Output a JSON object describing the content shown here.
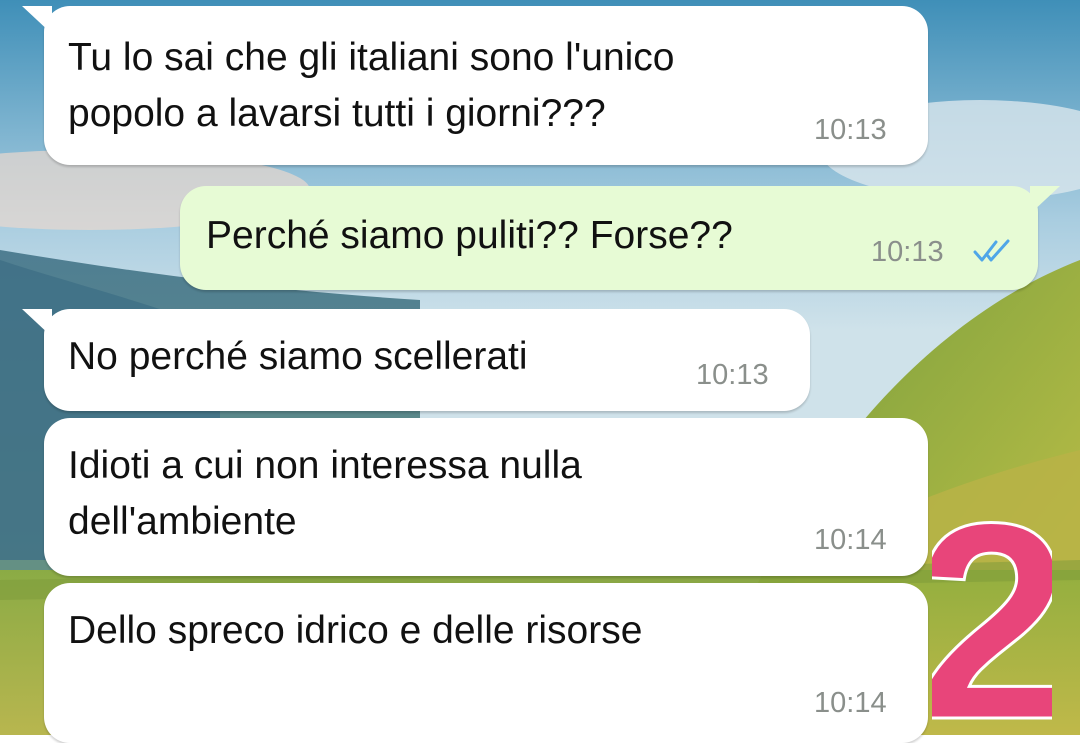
{
  "chat": {
    "messages": [
      {
        "direction": "incoming",
        "text": "Tu lo sai che gli italiani sono l'unico\npopolo a lavarsi tutti i giorni???",
        "time": "10:13"
      },
      {
        "direction": "outgoing",
        "text": "Perché siamo puliti?? Forse??",
        "time": "10:13",
        "status": "read"
      },
      {
        "direction": "incoming",
        "text": "No perché siamo scellerati",
        "time": "10:13"
      },
      {
        "direction": "incoming",
        "text": "Idioti a cui non interessa nulla\ndell'ambiente",
        "time": "10:14"
      },
      {
        "direction": "incoming",
        "text": "Dello spreco idrico e delle risorse",
        "time": "10:14"
      }
    ]
  },
  "overlay": {
    "sticker_text": "2",
    "sticker_color": "#e8457a"
  },
  "colors": {
    "incoming_bubble": "#ffffff",
    "outgoing_bubble": "#e7fbd5",
    "read_ticks": "#4fa6e8",
    "timestamp": "#8a8f8b"
  },
  "icons": {
    "read_status": "double-check-icon"
  }
}
